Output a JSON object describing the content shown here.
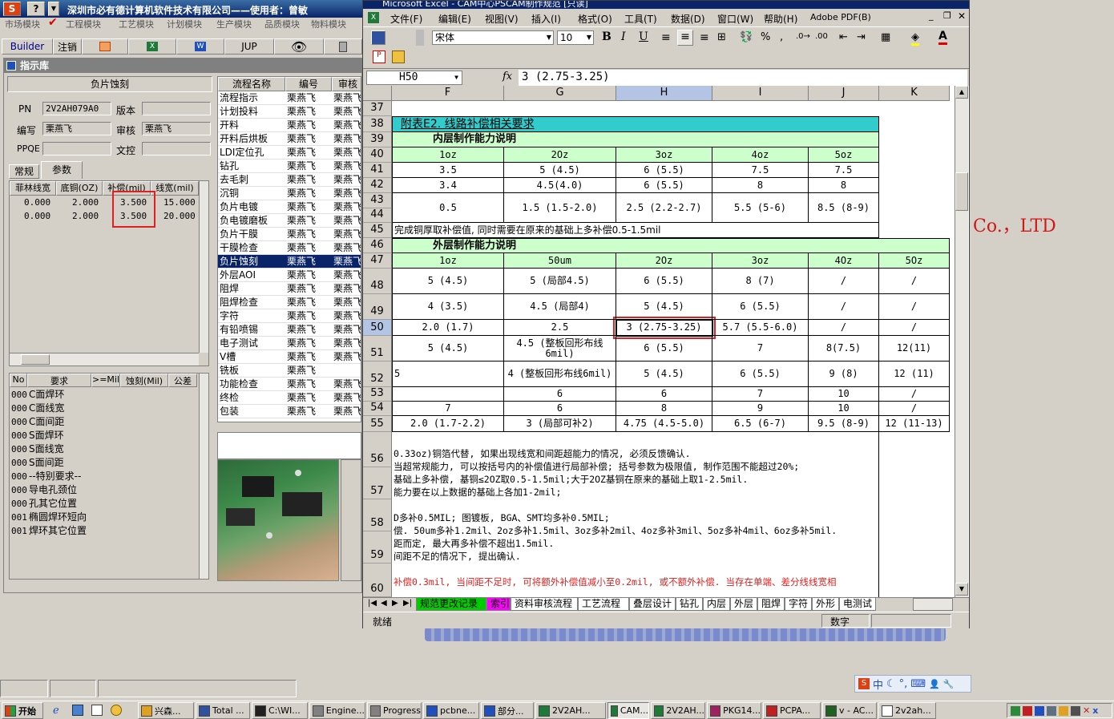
{
  "bg_app": {
    "title": "深圳市必有德计算机软件技术有限公司——使用者：曾敏",
    "menu": [
      "市场模块",
      "工程模块",
      "工艺模块",
      "计划模块",
      "生产模块",
      "品质模块",
      "物料模块"
    ],
    "toolbar": [
      "Builder",
      "注销",
      "",
      "",
      "W",
      "JUP",
      "",
      ""
    ],
    "panel_title": "指示库",
    "section_title": "负片蚀刻",
    "fields": {
      "pn_label": "PN",
      "pn_value": "2V2AH079A0",
      "version_label": "版本",
      "editor_label": "编写",
      "editor_value": "栗燕飞",
      "review_label": "审核",
      "review_value": "栗燕飞",
      "ppqe_label": "PPQE",
      "docs_label": "文控"
    },
    "tabs": [
      "常规",
      "参数"
    ],
    "param_headers": [
      "菲林线宽",
      "底铜(OZ)",
      "补偿(mil)",
      "线宽(mil)"
    ],
    "param_rows": [
      [
        "0.000",
        "2.000",
        "3.500",
        "15.000"
      ],
      [
        "0.000",
        "2.000",
        "3.500",
        "20.000"
      ]
    ],
    "req_headers": [
      "No",
      "要求",
      ">=Mil",
      "蚀刻(Mil)",
      "公差"
    ],
    "req_rows": [
      [
        "000",
        "C面焊环"
      ],
      [
        "000",
        "C面线宽"
      ],
      [
        "000",
        "C面间距"
      ],
      [
        "000",
        "S面焊环"
      ],
      [
        "000",
        "S面线宽"
      ],
      [
        "000",
        "S面间距"
      ],
      [
        "000",
        "--特别要求--"
      ],
      [
        "000",
        "导电孔颈位"
      ],
      [
        "000",
        "孔其它位置"
      ],
      [
        "001",
        "椭圆焊环短向"
      ],
      [
        "001",
        "焊环其它位置"
      ]
    ],
    "flow_headers": [
      "流程名称",
      "编号",
      "审核"
    ],
    "flow_rows": [
      [
        "流程指示",
        "栗燕飞",
        "栗燕飞"
      ],
      [
        "计划投料",
        "栗燕飞",
        "栗燕飞"
      ],
      [
        "开料",
        "栗燕飞",
        "栗燕飞"
      ],
      [
        "开料后烘板",
        "栗燕飞",
        "栗燕飞"
      ],
      [
        "LDI定位孔",
        "栗燕飞",
        "栗燕飞"
      ],
      [
        "钻孔",
        "栗燕飞",
        "栗燕飞"
      ],
      [
        "去毛刺",
        "栗燕飞",
        "栗燕飞"
      ],
      [
        "沉铜",
        "栗燕飞",
        "栗燕飞"
      ],
      [
        "负片电镀",
        "栗燕飞",
        "栗燕飞"
      ],
      [
        "负电镀磨板",
        "栗燕飞",
        "栗燕飞"
      ],
      [
        "负片干膜",
        "栗燕飞",
        "栗燕飞"
      ],
      [
        "干膜检查",
        "栗燕飞",
        "栗燕飞"
      ],
      [
        "负片蚀刻",
        "栗燕飞",
        "栗燕飞"
      ],
      [
        "外层AOI",
        "栗燕飞",
        "栗燕飞"
      ],
      [
        "阻焊",
        "栗燕飞",
        "栗燕飞"
      ],
      [
        "阻焊检查",
        "栗燕飞",
        "栗燕飞"
      ],
      [
        "字符",
        "栗燕飞",
        "栗燕飞"
      ],
      [
        "有铅喷锡",
        "栗燕飞",
        "栗燕飞"
      ],
      [
        "电子测试",
        "栗燕飞",
        "栗燕飞"
      ],
      [
        "V槽",
        "栗燕飞",
        "栗燕飞"
      ],
      [
        "铣板",
        "栗燕飞",
        ""
      ],
      [
        "功能检查",
        "栗燕飞",
        "栗燕飞"
      ],
      [
        "终检",
        "栗燕飞",
        "栗燕飞"
      ],
      [
        "包装",
        "栗燕飞",
        "栗燕飞"
      ]
    ],
    "company_logo": "Co.，LTD"
  },
  "excel": {
    "title": "Microsoft Excel - CAM中心PSCAM制作规范 [只读]",
    "menu": [
      "文件(F)",
      "编辑(E)",
      "视图(V)",
      "插入(I)",
      "格式(O)",
      "工具(T)",
      "数据(D)",
      "窗口(W)",
      "帮助(H)",
      "Adobe PDF(B)"
    ],
    "font_name": "宋体",
    "font_size": "10",
    "name_box": "H50",
    "formula": "3 (2.75-3.25)",
    "columns": [
      "F",
      "G",
      "H",
      "I",
      "J",
      "K"
    ],
    "rows": {
      "r37": "37",
      "r38": {
        "num": "38",
        "title": "附表E2. 线路补偿相关要求"
      },
      "r39": {
        "num": "39",
        "title": "内层制作能力说明"
      },
      "r40": {
        "num": "40",
        "cells": [
          "1oz",
          "2Oz",
          "3oz",
          "4oz",
          "5oz"
        ]
      },
      "r41": {
        "num": "41",
        "cells": [
          "3.5",
          "5 (4.5)",
          "6 (5.5)",
          "7.5",
          "7.5"
        ]
      },
      "r42": {
        "num": "42",
        "cells": [
          "3.4",
          "4.5(4.0)",
          "6 (5.5)",
          "8",
          "8"
        ]
      },
      "r43": {
        "num": "43",
        "cells": [
          "0.5",
          "1.5 (1.5-2.0)",
          "2.5 (2.2-2.7)",
          "5.5 (5-6)",
          "8.5 (8-9)"
        ]
      },
      "r44": "44",
      "r45": {
        "num": "45",
        "text": "完成铜厚取补偿值, 同时需要在原来的基础上多补偿0.5-1.5mil"
      },
      "r46": {
        "num": "46",
        "title": "外层制作能力说明"
      },
      "r47": {
        "num": "47",
        "cells": [
          "1oz",
          "50um",
          "2Oz",
          "3oz",
          "4Oz",
          "5Oz"
        ]
      },
      "r48": {
        "num": "48",
        "cells": [
          "5 (4.5)",
          "5 (局部4.5)",
          "6 (5.5)",
          "8 (7)",
          "/",
          "/"
        ]
      },
      "r49": {
        "num": "49",
        "cells": [
          "4 (3.5)",
          "4.5 (局部4)",
          "5 (4.5)",
          "6 (5.5)",
          "/",
          "/"
        ]
      },
      "r50": {
        "num": "50",
        "cells": [
          "2.0 (1.7)",
          "2.5",
          "3 (2.75-3.25)",
          "5.7 (5.5-6.0)",
          "/",
          "/"
        ]
      },
      "r51": {
        "num": "51",
        "cells": [
          "5 (4.5)",
          "4.5 (整板回形布线6mil)",
          "6 (5.5)",
          "7",
          "8(7.5)",
          "12(11)"
        ]
      },
      "r52": {
        "num": "52",
        "cells": [
          "5",
          "4 (整板回形布线6mil)",
          "5 (4.5)",
          "6 (5.5)",
          "9 (8)",
          "12 (11)"
        ]
      },
      "r53": {
        "num": "53",
        "cells": [
          "",
          "6",
          "6",
          "7",
          "10",
          "/"
        ]
      },
      "r54": {
        "num": "54",
        "cells": [
          "7",
          "6",
          "8",
          "9",
          "10",
          "/"
        ]
      },
      "r55": {
        "num": "55",
        "cells": [
          "2.0 (1.7-2.2)",
          "3 (局部可补2)",
          "4.75 (4.5-5.0)",
          "6.5 (6-7)",
          "9.5 (8-9)",
          "12 (11-13)"
        ]
      },
      "r56": "56",
      "r57": "57",
      "r58": "58",
      "r59": "59",
      "r60": "60"
    },
    "notes": [
      "0.33oz)铜箔代替, 如果出现线宽和间距超能力的情况, 必须反馈确认.",
      "当超常规能力, 可以按括号内的补偿值进行局部补偿; 括号参数为极限值, 制作范围不能超过20%;",
      "基础上多补偿, 基铜≤2OZ取0.5-1.5mil;大于2OZ基铜在原来的基础上取1-2.5mil.",
      "能力要在以上数据的基础上各加1-2mil;",
      "D多补0.5MIL; 图镀板, BGA、SMT均多补0.5MIL;",
      "偿. 50um多补1.2mil、2oz多补1.5mil、3oz多补2mil、4oz多补3mil、5oz多补4mil、6oz多补5mil.",
      "距而定, 最大再多补偿不超出1.5mil.",
      "间距不足的情况下, 提出确认.",
      "补偿0.3mil, 当间距不足时, 可将额外补偿值减小至0.2mil, 或不额外补偿. 当存在单端、差分线线宽相"
    ],
    "sheet_tabs": [
      "规范更改记录",
      "索引",
      "资料审核流程",
      "工艺流程",
      "叠层设计",
      "钻孔",
      "内层",
      "外层",
      "阻焊",
      "字符",
      "外形",
      "电测试"
    ],
    "status_left": "就绪",
    "status_right": "数字"
  },
  "ime": [
    "S",
    "中",
    "☾",
    "°,",
    "⌨",
    "👤",
    "🔧"
  ],
  "taskbar": {
    "start": "开始",
    "items": [
      "兴森...",
      "Total ...",
      "C:\\WI...",
      "Engine...",
      "Progress",
      "pcbne...",
      "部分...",
      "2V2AH...",
      "CAM...",
      "2V2AH...",
      "PKG14...",
      "PCPA...",
      "v - AC...",
      "2v2ah..."
    ]
  },
  "colors": {
    "title_blue": "#0a246a",
    "header_cyan": "#33cccc",
    "light_green": "#ccffcc",
    "highlight_red": "#e02020"
  }
}
